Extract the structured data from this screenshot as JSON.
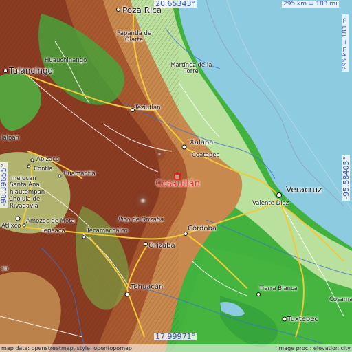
{
  "map": {
    "target_label": "Cosautlán",
    "coords": {
      "top": "20.65343°",
      "bottom": "17.99971°",
      "left": "-98.39655°",
      "right": "-95.58405°"
    },
    "scale_top": "295 km = 183 mi",
    "scale_right": "295 km = 183 mi",
    "places": {
      "poza_rica": "Poza Rica",
      "papantla": "Papantla de\nOlarte",
      "huauchinango": "Huauchinango",
      "tulancingo": "Tulancingo",
      "martinez": "Martínez de la\nTorre",
      "teziutlan": "Teziutlán",
      "xalapa": "Xalapa",
      "coatepec": "Coatepec",
      "apizaco": "Apizaco",
      "contla": "Contla",
      "melucan": "melucan",
      "santa_ana": "Santa Ana",
      "chiautempan": "hiautempan",
      "cholula": "Cholula de",
      "rivadavia": "Rivadavia",
      "huamantla": "Huamantla",
      "veracruz": "Veracruz",
      "valente_diaz": "Valente Díaz",
      "pico": "Pico de Orizaba",
      "cordoba": "Córdoba",
      "amozoc": "Amozoc de Mota",
      "atlixco": "Atlixco",
      "tepeaca": "Tepeaca",
      "tecamachalco": "Tecamachalco",
      "orizaba": "Orizaba",
      "tehuacan": "Tehuacán",
      "tierra_blanca": "Tierra Blanca",
      "cosamaloapan": "Cosama",
      "tuxtepec": "Tuxtepec",
      "tlalpan": "lalpan",
      "clipped_co": "co"
    },
    "credits": {
      "left": "map data: openstreetmap, style: opentopomap",
      "right": "image proc.: elevation.city"
    },
    "colors": {
      "sea": "#8ccbe0",
      "lowland": "#3fae3c",
      "plain": "#bde8a4",
      "highland": "#a85a30",
      "mountain": "#7a2e1c",
      "road_major": "#f2c938",
      "road_minor": "#ffffff",
      "coord_text": "#3a50c8",
      "target": "#e23232"
    }
  }
}
